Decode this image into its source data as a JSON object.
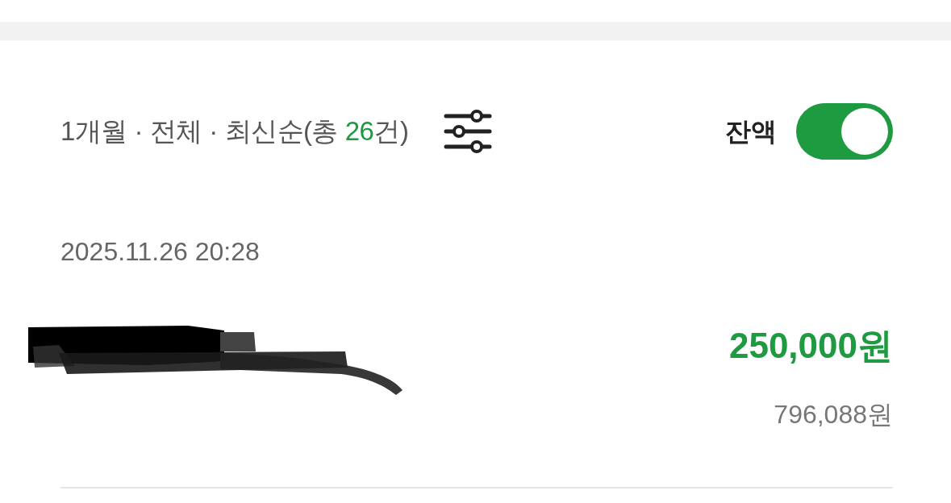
{
  "filter": {
    "summary_before": "1개월 · 전체 · 최신순(총 ",
    "count": "26",
    "summary_after": "건)"
  },
  "balance_toggle": {
    "label": "잔액",
    "on": true
  },
  "transactions": [
    {
      "datetime": "2025.11.26 20:28",
      "redacted": true,
      "amount": "250,000원",
      "balance": "796,088원"
    }
  ]
}
